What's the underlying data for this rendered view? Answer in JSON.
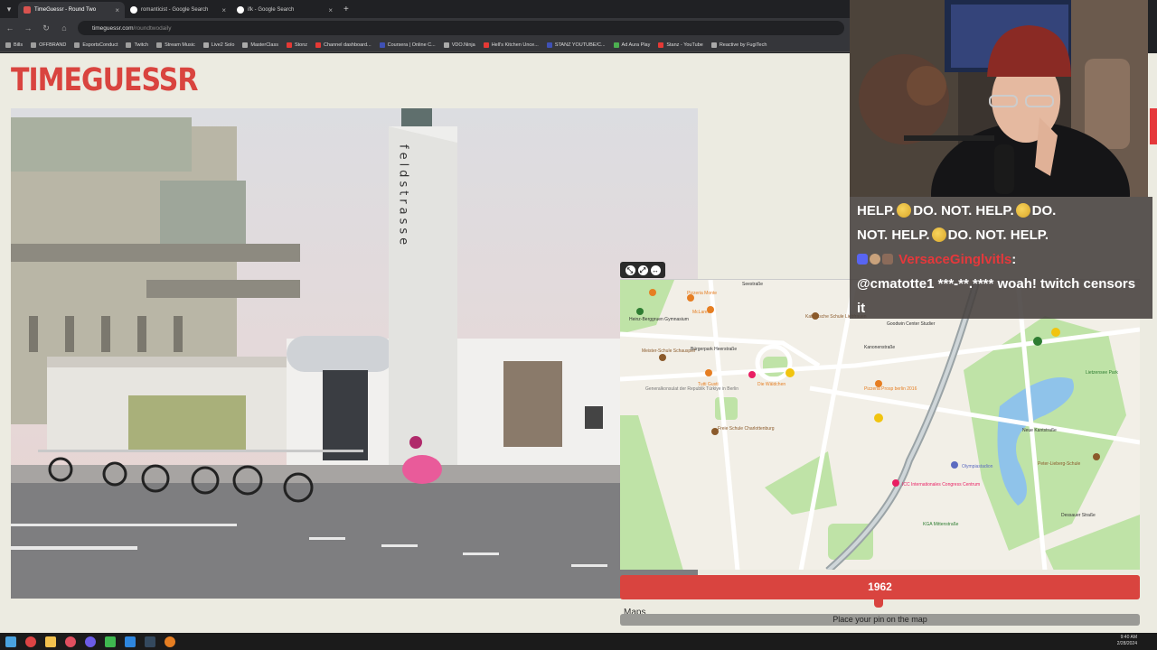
{
  "browser": {
    "tabs": [
      {
        "title": "TimeGuessr - Round Two",
        "active": true
      },
      {
        "title": "romanticist - Google Search",
        "active": false
      },
      {
        "title": "ifk - Google Search",
        "active": false
      }
    ],
    "new_tab": "+",
    "url_domain": "timeguessr.com",
    "url_path": "/roundtwodaily",
    "bookmarks": [
      "Bills",
      "OFFBRAND",
      "EsportsConduct",
      "Twitch",
      "Stream Music",
      "Live2 Solo",
      "MasterClass",
      "Stonz",
      "Channel dashboard...",
      "Coursera | Online C...",
      "VDO.Ninja",
      "Hell's Kitchen Unce...",
      "STANZ YOUTUBE/C...",
      "Ad Aura Play",
      "Stanz - YouTube",
      "Reactive by FugiTech"
    ]
  },
  "page": {
    "logo": "TIMEGUESSR",
    "photo_sign": "feldstrasse",
    "map_controls": [
      "⤡",
      "⤢",
      "↔"
    ],
    "maps_attribution": "Maps",
    "year_value": "1962",
    "pin_prompt": "Place your pin on the map"
  },
  "map": {
    "labels": [
      {
        "text": "Seestraße",
        "color": "#333"
      },
      {
        "text": "Pizzeria Monte",
        "color": "#e67e22"
      },
      {
        "text": "McLaren",
        "color": "#e67e22"
      },
      {
        "text": "Katholische Schule Liebfrauen",
        "color": "#8b5a2b"
      },
      {
        "text": "Heinz-Berggruen Gymnasium",
        "color": "#333"
      },
      {
        "text": "Goodwin Center Studier",
        "color": "#333"
      },
      {
        "text": "Meister-Schule Schauspiel",
        "color": "#8b5a2b"
      },
      {
        "text": "Bürgerpark Heerstraße",
        "color": "#333"
      },
      {
        "text": "Kanonenstraße",
        "color": "#333"
      },
      {
        "text": "Die Wäldchen",
        "color": "#e67e22"
      },
      {
        "text": "Tutti Gusti",
        "color": "#e67e22"
      },
      {
        "text": "Pizzeria Prosp berlin 2016",
        "color": "#e67e22"
      },
      {
        "text": "Generalkonsulat der Republik Türkiye in Berlin",
        "color": "#777"
      },
      {
        "text": "Freie Schule Charlottenburg",
        "color": "#8b5a2b"
      },
      {
        "text": "ICC Internationales Congress Centrum",
        "color": "#e91e63"
      },
      {
        "text": "Olympiastadion",
        "color": "#5c6bc0"
      },
      {
        "text": "KGA Mittenstraße",
        "color": "#2e7d32"
      },
      {
        "text": "Peter-Lieberg-Schule",
        "color": "#8b5a2b"
      },
      {
        "text": "Lietzensee Park",
        "color": "#2e7d32"
      },
      {
        "text": "Neue Kantstraße",
        "color": "#333"
      },
      {
        "text": "Dessauer Straße",
        "color": "#333"
      }
    ]
  },
  "overlay": {
    "chat_line1_a": "HELP.",
    "chat_line1_b": "DO. NOT. HELP.",
    "chat_line1_c": "DO.",
    "chat_line2_a": "NOT. HELP.",
    "chat_line2_b": "DO. NOT. HELP.",
    "chat_user": "VersaceGinglvitls",
    "chat_user_sep": ":",
    "chat_message": "@cmatotte1 ***-**.**** woah! twitch censors it"
  },
  "taskbar": {
    "time": "9:40 AM",
    "date": "2/28/2024"
  }
}
